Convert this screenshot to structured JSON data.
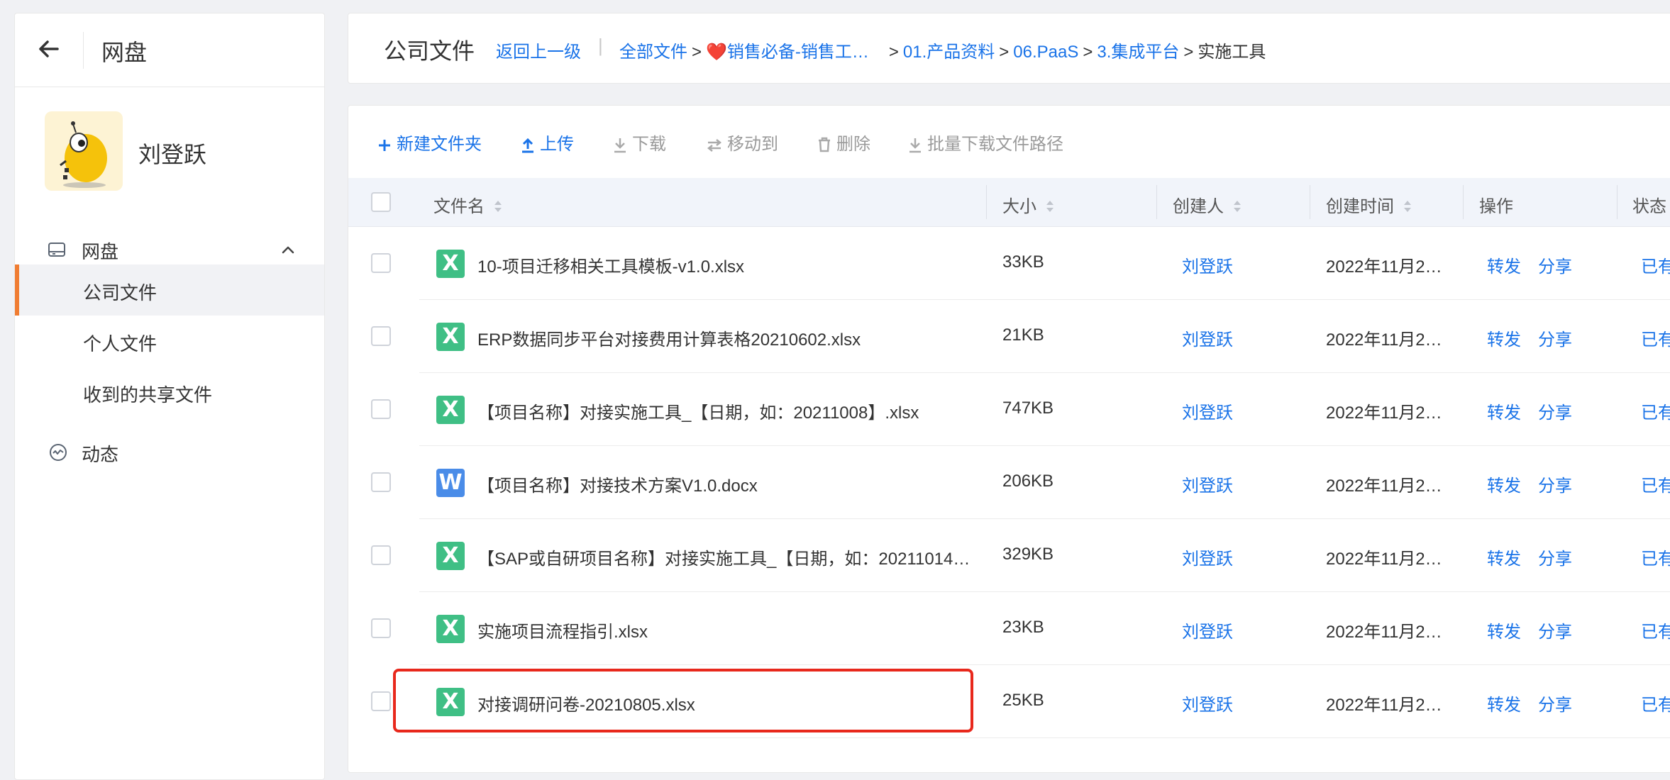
{
  "sidebar": {
    "title": "网盘",
    "user_name": "刘登跃",
    "group_label": "网盘",
    "items": [
      {
        "label": "公司文件",
        "active": true
      },
      {
        "label": "个人文件",
        "active": false
      },
      {
        "label": "收到的共享文件",
        "active": false
      }
    ],
    "dynamic_label": "动态"
  },
  "topbar": {
    "title": "公司文件",
    "back_label": "返回上一级",
    "separator": "|",
    "crumbs": {
      "all_files": "全部文件",
      "sales": "❤️销售必备-销售工…",
      "product": "01.产品资料",
      "paas": "06.PaaS",
      "integration": "3.集成平台",
      "current": "实施工具"
    }
  },
  "toolbar": {
    "new_folder": "新建文件夹",
    "upload": "上传",
    "download": "下载",
    "move_to": "移动到",
    "delete": "删除",
    "batch_download": "批量下载文件路径"
  },
  "table": {
    "headers": {
      "name": "文件名",
      "size": "大小",
      "creator": "创建人",
      "created": "创建时间",
      "ops": "操作",
      "status": "状态"
    },
    "rows": [
      {
        "type": "X",
        "name": "10-项目迁移相关工具模板-v1.0.xlsx",
        "size": "33KB",
        "creator": "刘登跃",
        "time": "2022年11月2…",
        "op1": "转发",
        "op2": "分享",
        "status": "已有"
      },
      {
        "type": "X",
        "name": "ERP数据同步平台对接费用计算表格20210602.xlsx",
        "size": "21KB",
        "creator": "刘登跃",
        "time": "2022年11月2…",
        "op1": "转发",
        "op2": "分享",
        "status": "已有"
      },
      {
        "type": "X",
        "name": "【项目名称】对接实施工具_【日期，如：20211008】.xlsx",
        "size": "747KB",
        "creator": "刘登跃",
        "time": "2022年11月2…",
        "op1": "转发",
        "op2": "分享",
        "status": "已有"
      },
      {
        "type": "W",
        "name": "【项目名称】对接技术方案V1.0.docx",
        "size": "206KB",
        "creator": "刘登跃",
        "time": "2022年11月2…",
        "op1": "转发",
        "op2": "分享",
        "status": "已有"
      },
      {
        "type": "X",
        "name": "【SAP或自研项目名称】对接实施工具_【日期，如：20211014…",
        "size": "329KB",
        "creator": "刘登跃",
        "time": "2022年11月2…",
        "op1": "转发",
        "op2": "分享",
        "status": "已有"
      },
      {
        "type": "X",
        "name": "实施项目流程指引.xlsx",
        "size": "23KB",
        "creator": "刘登跃",
        "time": "2022年11月2…",
        "op1": "转发",
        "op2": "分享",
        "status": "已有"
      },
      {
        "type": "X",
        "name": "对接调研问卷-20210805.xlsx",
        "size": "25KB",
        "creator": "刘登跃",
        "time": "2022年11月2…",
        "op1": "转发",
        "op2": "分享",
        "status": "已有"
      }
    ]
  },
  "colors": {
    "link": "#1a73e8",
    "active_accent": "#f07d32",
    "excel_icon": "#3fbf85",
    "word_icon": "#4a8ce8",
    "highlight": "#e8281c"
  }
}
